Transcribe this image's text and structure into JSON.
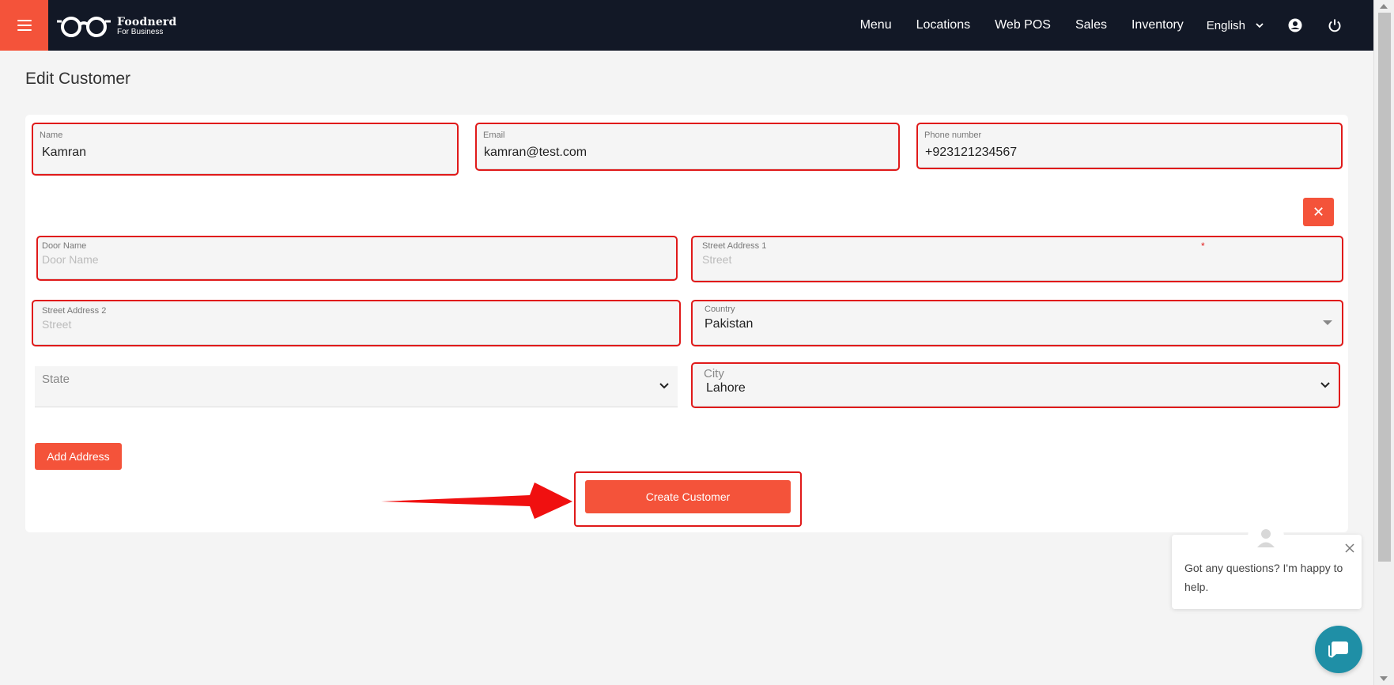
{
  "brand": {
    "name": "Foodnerd",
    "tagline": "For Business"
  },
  "nav": {
    "items": [
      "Menu",
      "Locations",
      "Web POS",
      "Sales",
      "Inventory"
    ],
    "language": "English",
    "icons": [
      "account-icon",
      "power-icon"
    ]
  },
  "page": {
    "title": "Edit Customer"
  },
  "form": {
    "name": {
      "label": "Name",
      "value": "Kamran"
    },
    "email": {
      "label": "Email",
      "value": "kamran@test.com"
    },
    "phone": {
      "label": "Phone number",
      "value": "+923121234567"
    },
    "door_name": {
      "label": "Door Name",
      "placeholder": "Door Name"
    },
    "street1": {
      "label": "Street Address 1",
      "placeholder": "Street",
      "required": "*"
    },
    "street2": {
      "label": "Street Address 2",
      "placeholder": "Street"
    },
    "country": {
      "label": "Country",
      "value": "Pakistan"
    },
    "state": {
      "label": "State",
      "value": ""
    },
    "city": {
      "label": "City",
      "value": "Lahore"
    },
    "remove_label": "✕",
    "add_address_label": "Add Address",
    "create_label": "Create Customer"
  },
  "chat": {
    "message": "Got any questions? I'm happy to help."
  },
  "colors": {
    "accent": "#f4533a",
    "nav_bg": "#121826",
    "highlight": "#e01a1a",
    "chat": "#1f8fa6"
  }
}
